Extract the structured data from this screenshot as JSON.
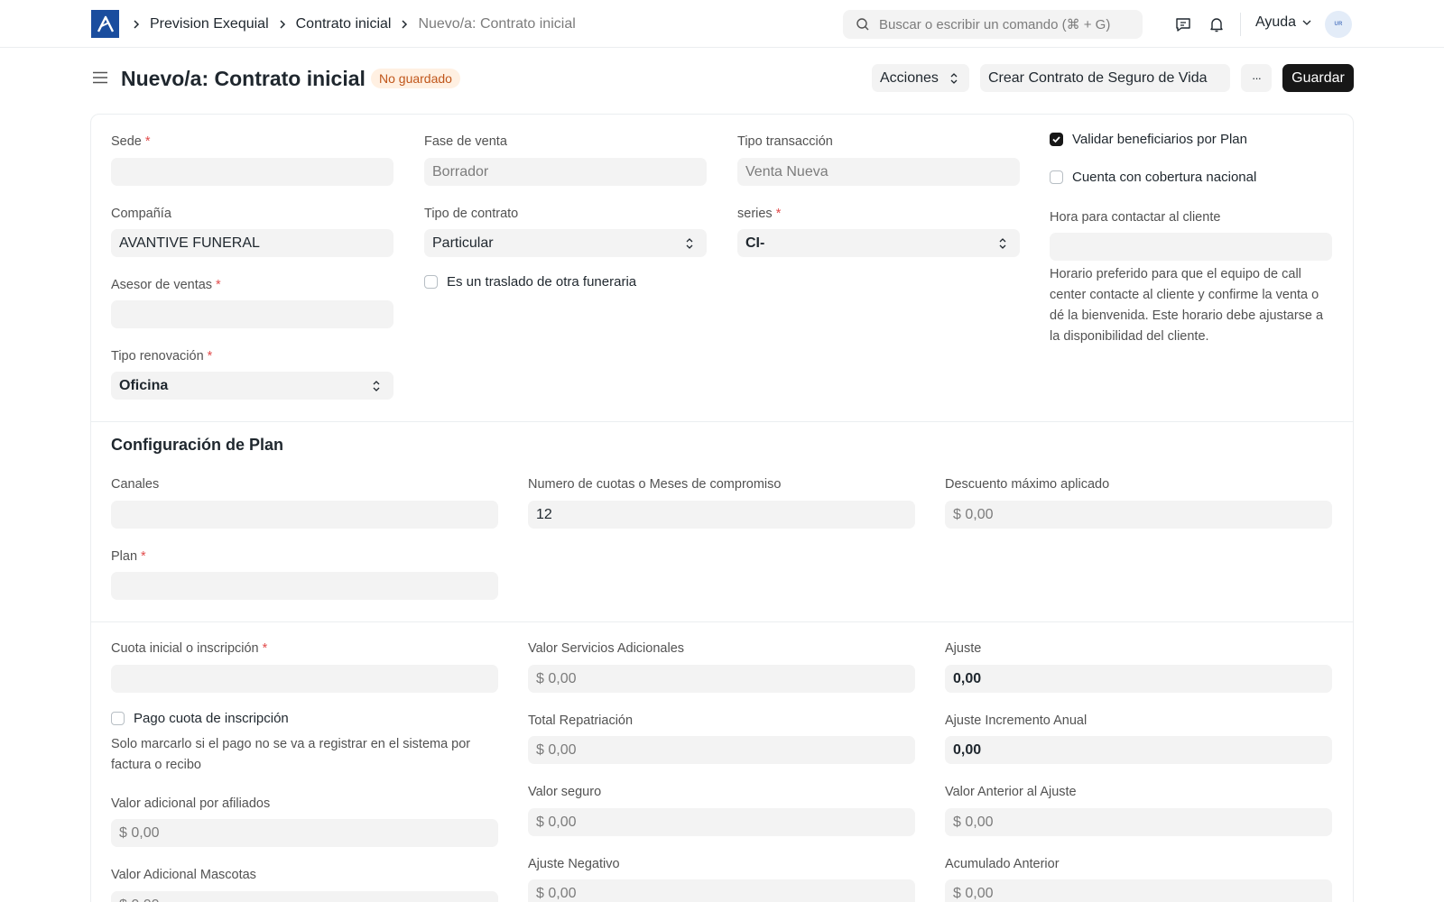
{
  "navbar": {
    "breadcrumbs": [
      "Prevision Exequial",
      "Contrato inicial",
      "Nuevo/a: Contrato inicial"
    ],
    "search_placeholder": "Buscar o escribir un comando (⌘ + G)",
    "help_label": "Ayuda",
    "avatar_initials": "UR"
  },
  "page": {
    "title": "Nuevo/a: Contrato inicial",
    "status_badge": "No guardado",
    "actions_label": "Acciones",
    "create_label": "Crear Contrato de Seguro de Vida",
    "more_label": "···",
    "save_label": "Guardar"
  },
  "section1": {
    "sede": {
      "label": "Sede",
      "value": ""
    },
    "fase_venta": {
      "label": "Fase de venta",
      "value": "Borrador"
    },
    "tipo_transaccion": {
      "label": "Tipo transacción",
      "value": "Venta Nueva"
    },
    "validar_beneficiarios": {
      "label": "Validar beneficiarios por Plan",
      "checked": true
    },
    "cobertura_nacional": {
      "label": "Cuenta con cobertura nacional",
      "checked": false
    },
    "compania": {
      "label": "Compañía",
      "value": "AVANTIVE FUNERAL"
    },
    "tipo_contrato": {
      "label": "Tipo de contrato",
      "value": "Particular"
    },
    "series": {
      "label": "series",
      "value": "CI-"
    },
    "hora_contacto": {
      "label": "Hora para contactar al cliente",
      "value": "",
      "help": "Horario preferido para que el equipo de call center contacte al cliente y confirme la venta o dé la bienvenida. Este horario debe ajustarse a la disponibilidad del cliente."
    },
    "traslado": {
      "label": "Es un traslado de otra funeraria",
      "checked": false
    },
    "asesor": {
      "label": "Asesor de ventas",
      "value": ""
    },
    "tipo_renovacion": {
      "label": "Tipo renovación",
      "value": "Oficina"
    }
  },
  "section2": {
    "title": "Configuración de Plan",
    "canales": {
      "label": "Canales",
      "value": ""
    },
    "cuotas": {
      "label": "Numero de cuotas o Meses de compromiso",
      "value": "12"
    },
    "descuento": {
      "label": "Descuento máximo aplicado",
      "value": "$ 0,00"
    },
    "plan": {
      "label": "Plan",
      "value": ""
    }
  },
  "section3": {
    "cuota_inicial": {
      "label": "Cuota inicial o inscripción",
      "value": ""
    },
    "pago_cuota": {
      "label": "Pago cuota de inscripción",
      "checked": false,
      "help": "Solo marcarlo si el pago no se va a registrar en el sistema por factura o recibo"
    },
    "valor_afiliados": {
      "label": "Valor adicional por afiliados",
      "value": "$ 0,00"
    },
    "valor_mascotas": {
      "label": "Valor Adicional Mascotas",
      "value": "$ 0,00"
    },
    "valor_servicios": {
      "label": "Valor Servicios Adicionales",
      "value": "$ 0,00"
    },
    "total_repatriacion": {
      "label": "Total Repatriación",
      "value": "$ 0,00"
    },
    "valor_seguro": {
      "label": "Valor seguro",
      "value": "$ 0,00"
    },
    "ajuste_negativo": {
      "label": "Ajuste Negativo",
      "value": "$ 0,00"
    },
    "ajuste": {
      "label": "Ajuste",
      "value": "0,00"
    },
    "ajuste_anual": {
      "label": "Ajuste Incremento Anual",
      "value": "0,00"
    },
    "valor_anterior": {
      "label": "Valor Anterior al Ajuste",
      "value": "$ 0,00"
    },
    "acumulado": {
      "label": "Acumulado Anterior",
      "value": "$ 0,00"
    }
  }
}
